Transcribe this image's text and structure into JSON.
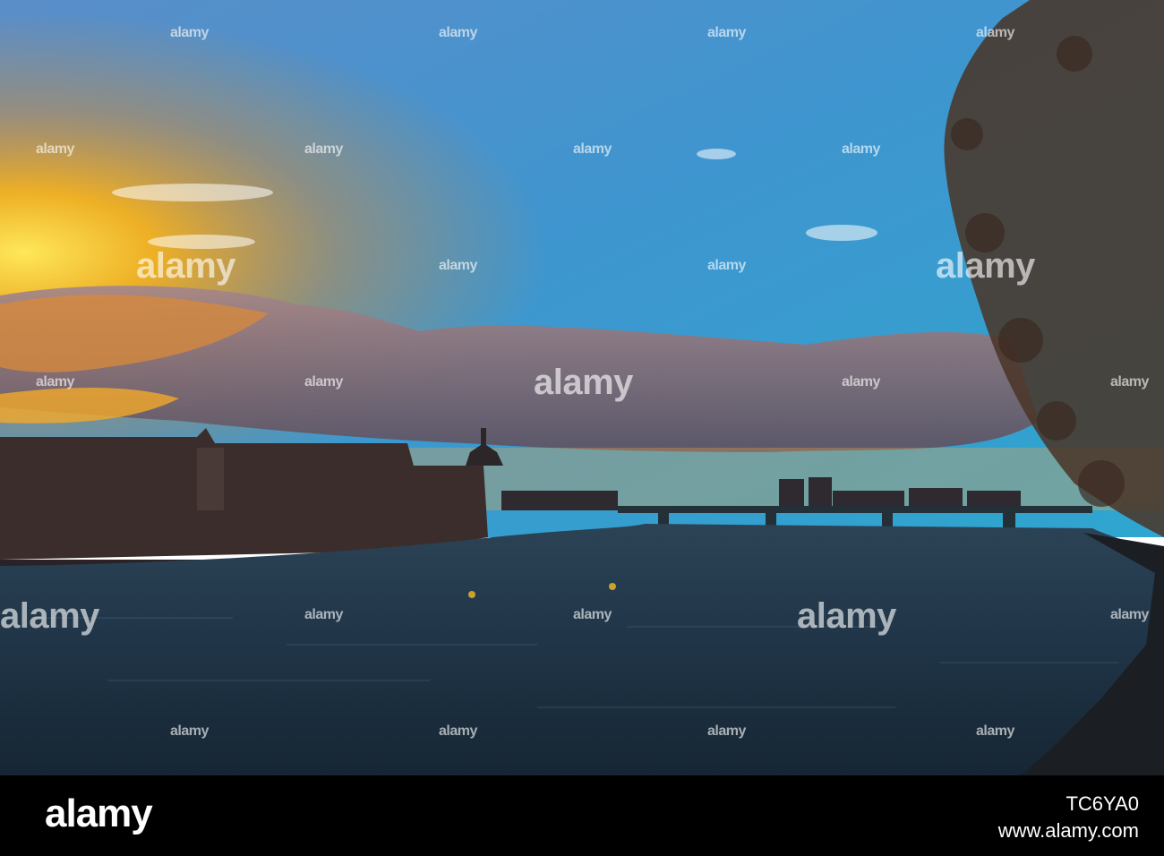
{
  "photo": {
    "description_icon": "riverside-sunset-photo",
    "watermark_text": "alamy",
    "colors": {
      "sky_top": "#3f86c8",
      "sky_mid": "#3aa0cf",
      "sunset": "#f3a51b",
      "water": "#1d2f3d"
    }
  },
  "footer": {
    "logo": "alamy",
    "image_id": "TC6YA0",
    "url": "www.alamy.com"
  }
}
